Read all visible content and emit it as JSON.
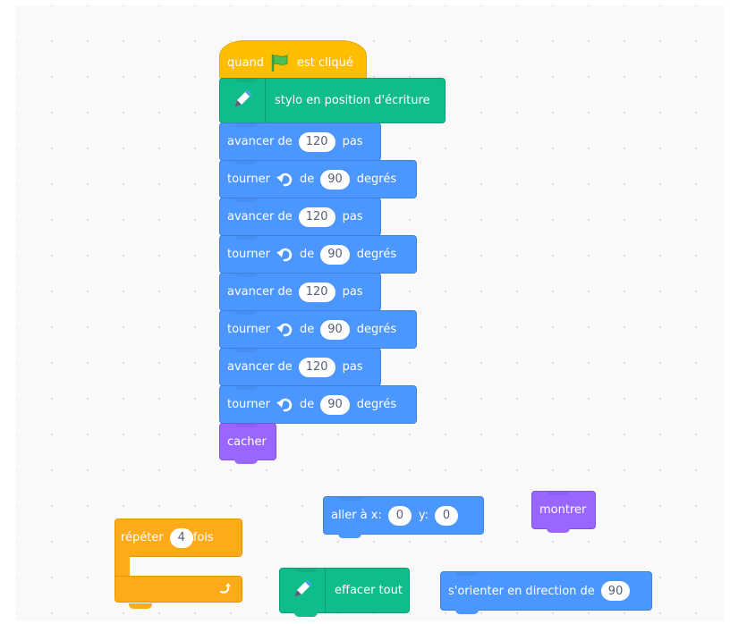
{
  "event_block": {
    "before": "quand",
    "flag_icon": "green-flag-icon",
    "after": "est cliqué"
  },
  "pen_down_block": {
    "label": "stylo en position d'écriture",
    "icon": "pen-icon"
  },
  "script_blocks": [
    {
      "type": "move",
      "label": "avancer de",
      "value": "120",
      "unit": "pas"
    },
    {
      "type": "turn",
      "label": "tourner",
      "icon": "rotate-left-icon",
      "mid": "de",
      "value": "90",
      "unit": "degrés"
    },
    {
      "type": "move",
      "label": "avancer de",
      "value": "120",
      "unit": "pas"
    },
    {
      "type": "turn",
      "label": "tourner",
      "icon": "rotate-left-icon",
      "mid": "de",
      "value": "90",
      "unit": "degrés"
    },
    {
      "type": "move",
      "label": "avancer de",
      "value": "120",
      "unit": "pas"
    },
    {
      "type": "turn",
      "label": "tourner",
      "icon": "rotate-left-icon",
      "mid": "de",
      "value": "90",
      "unit": "degrés"
    },
    {
      "type": "move",
      "label": "avancer de",
      "value": "120",
      "unit": "pas"
    },
    {
      "type": "turn",
      "label": "tourner",
      "icon": "rotate-left-icon",
      "mid": "de",
      "value": "90",
      "unit": "degrés"
    }
  ],
  "hide_block": {
    "label": "cacher"
  },
  "goto_block": {
    "label": "aller à x:",
    "x_value": "0",
    "y_label": "y:",
    "y_value": "0"
  },
  "show_block": {
    "label": "montrer"
  },
  "repeat_block": {
    "label": "répéter",
    "value": "4",
    "unit": "fois",
    "loop_icon": "loop-arrow-icon"
  },
  "clear_block": {
    "label": "effacer tout",
    "icon": "pen-icon"
  },
  "point_block": {
    "label": "s'orienter en direction de",
    "value": "90"
  },
  "colors": {
    "motion": "#4c97ff",
    "pen": "#0fbd8c",
    "looks": "#9966ff",
    "events": "#ffbf00",
    "control": "#ffab19",
    "workspace": "#f9f9f9"
  }
}
